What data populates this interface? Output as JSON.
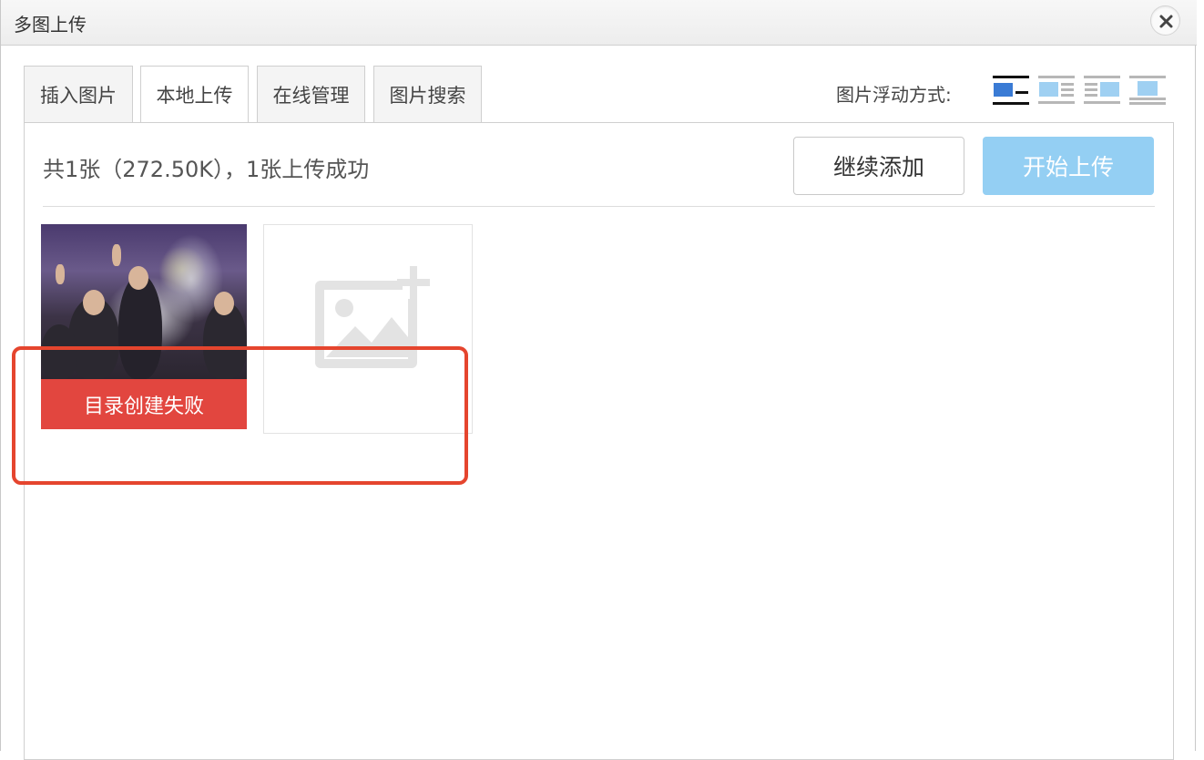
{
  "dialog": {
    "title": "多图上传",
    "close_icon": "close-icon"
  },
  "tabs": [
    {
      "label": "插入图片",
      "active": false
    },
    {
      "label": "本地上传",
      "active": true
    },
    {
      "label": "在线管理",
      "active": false
    },
    {
      "label": "图片搜索",
      "active": false
    }
  ],
  "float_options": {
    "label": "图片浮动方式:",
    "icons": [
      "float-none-icon",
      "float-left-icon",
      "float-right-icon",
      "float-center-icon"
    ],
    "selected_index": 0
  },
  "upload": {
    "status_text": "共1张（272.50K），1张上传成功",
    "continue_label": "继续添加",
    "start_label": "开始上传",
    "start_color": "#94cff3"
  },
  "files": [
    {
      "error_text": "目录创建失败",
      "error_color": "#e2463f"
    }
  ],
  "add_box": {
    "icon": "add-image-icon"
  },
  "colors": {
    "highlight": "#e5452e",
    "active_float": "#3a7bd5"
  }
}
